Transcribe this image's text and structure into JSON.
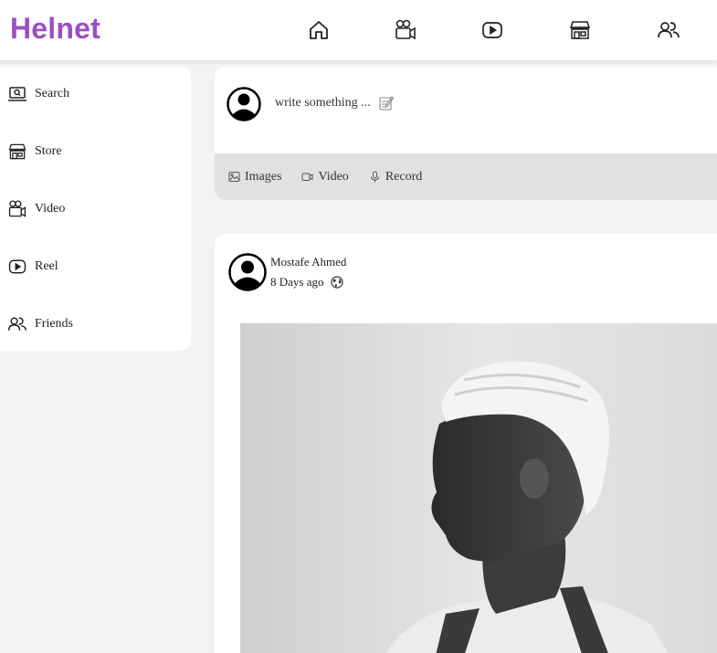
{
  "header": {
    "brand": "Helnet",
    "nav": [
      {
        "name": "home-icon"
      },
      {
        "name": "video-camera-icon"
      },
      {
        "name": "reel-play-icon"
      },
      {
        "name": "store-icon"
      },
      {
        "name": "friends-icon"
      }
    ]
  },
  "sidebar": {
    "items": [
      {
        "label": "Search",
        "icon": "search-icon"
      },
      {
        "label": "Store",
        "icon": "store-icon"
      },
      {
        "label": "Video",
        "icon": "video-camera-icon"
      },
      {
        "label": "Reel",
        "icon": "reel-play-icon"
      },
      {
        "label": "Friends",
        "icon": "friends-icon"
      }
    ]
  },
  "composer": {
    "placeholder": "write something ...",
    "actions": [
      {
        "label": "Images",
        "icon": "image-icon"
      },
      {
        "label": "Video",
        "icon": "video-icon"
      },
      {
        "label": "Record",
        "icon": "microphone-icon"
      }
    ]
  },
  "post": {
    "author": "Mostafe Ahmed",
    "time": "8 Days ago",
    "visibility_icon": "globe-icon"
  },
  "colors": {
    "brand": "#9b4fc1",
    "background": "#f3f3f3",
    "action_bar": "#e1e1e1"
  }
}
